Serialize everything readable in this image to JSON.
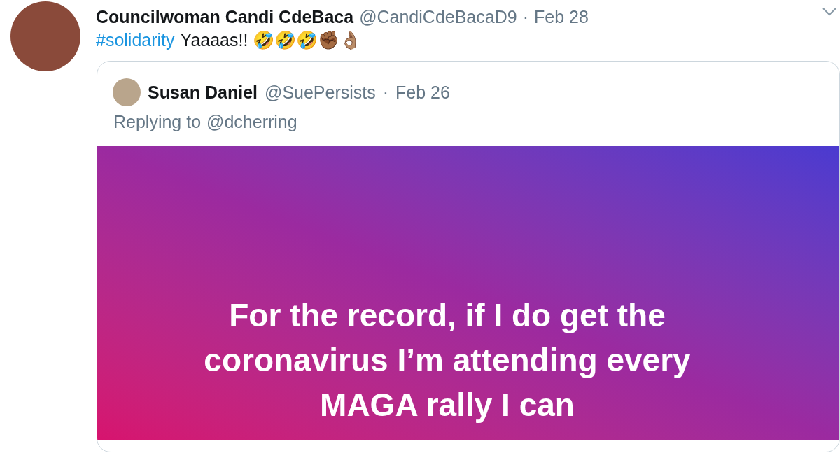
{
  "tweet": {
    "name": "Councilwoman Candi CdeBaca",
    "handle": "@CandiCdeBacaD9",
    "separator": "·",
    "date": "Feb 28",
    "hashtag": "#solidarity",
    "text": "Yaaaas!! 🤣🤣🤣✊🏾👌🏽"
  },
  "quoted_tweet": {
    "name": "Susan Daniel",
    "handle": "@SuePersists",
    "separator": "·",
    "date": "Feb 26",
    "reply_prefix": "Replying to",
    "reply_to": "@dcherring",
    "image_text": [
      "For the record, if I do get the",
      "coronavirus I’m attending every",
      "MAGA rally I can"
    ]
  }
}
